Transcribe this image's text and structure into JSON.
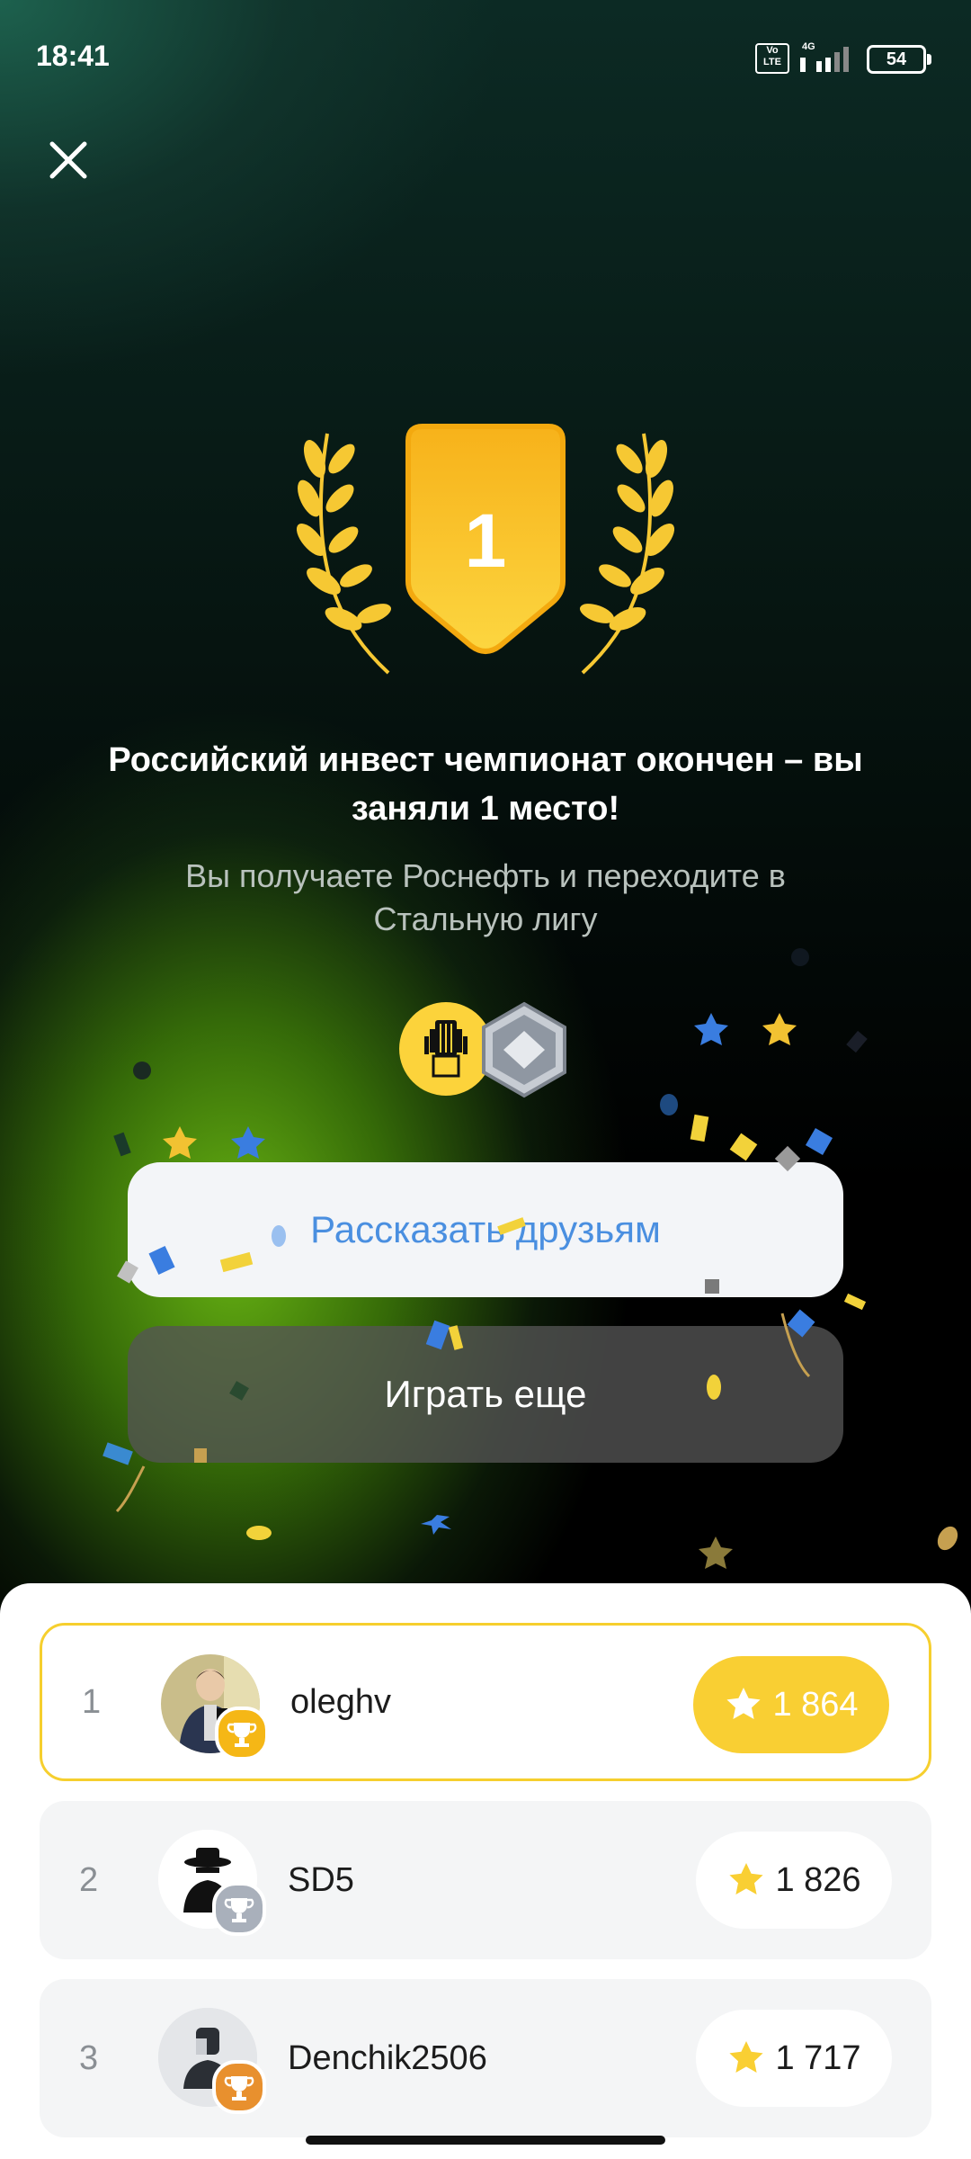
{
  "status_bar": {
    "time": "18:41",
    "network": "4G",
    "volte": "Vo LTE",
    "battery": "54"
  },
  "result": {
    "place": "1",
    "headline": "Российский инвест чемпионат окончен – вы заняли 1 место!",
    "subtitle": "Вы получаете Роснефть и переходите в Стальную лигу"
  },
  "actions": {
    "share_label": "Рассказать друзьям",
    "play_label": "Играть еще"
  },
  "leaderboard": [
    {
      "rank": "1",
      "name": "oleghv",
      "score": "1 864",
      "medal": "gold",
      "current_user": true
    },
    {
      "rank": "2",
      "name": "SD5",
      "score": "1 826",
      "medal": "silver",
      "current_user": false
    },
    {
      "rank": "3",
      "name": "Denchik2506",
      "score": "1 717",
      "medal": "bronze",
      "current_user": false
    }
  ],
  "colors": {
    "accent_yellow": "#f9cf33",
    "share_text": "#4a8fe0",
    "gold": "#f5b716",
    "silver": "#a9b0bb",
    "bronze": "#e8902e"
  },
  "icons": {
    "close": "close-icon",
    "trophy": "laurel-shield-icon",
    "reward_company": "rosneft-logo-icon",
    "reward_league": "steel-league-icon",
    "score": "star-icon",
    "medal": "trophy-icon"
  }
}
